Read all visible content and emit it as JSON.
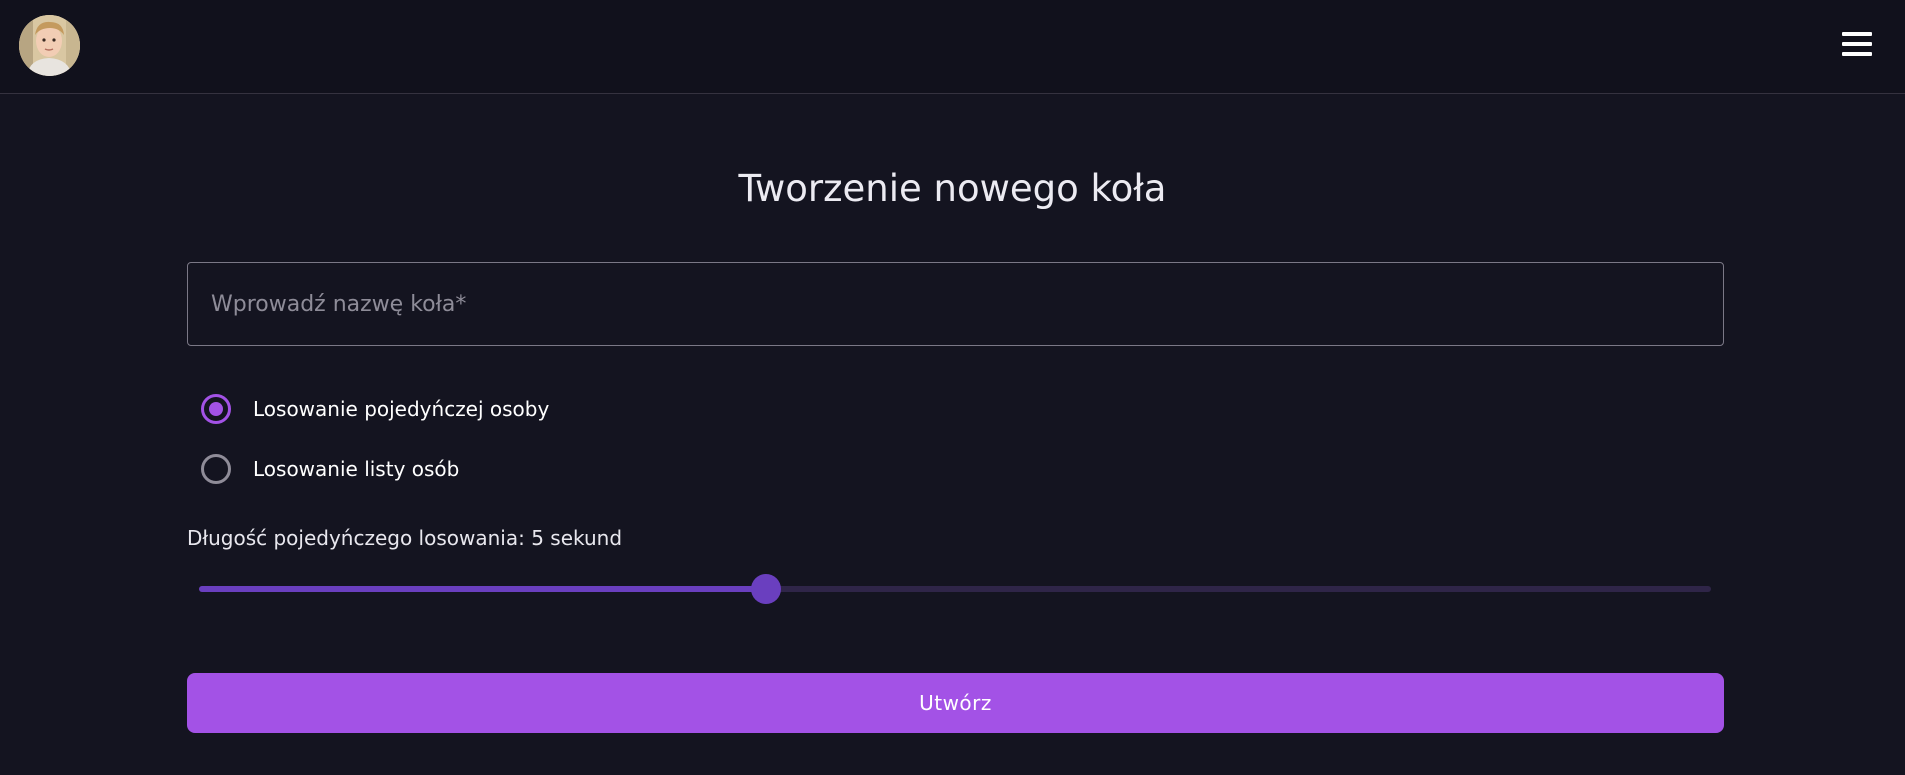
{
  "header": {
    "avatar_icon": "user-avatar-photo",
    "menu_icon": "hamburger-menu-icon"
  },
  "page": {
    "title": "Tworzenie nowego koła"
  },
  "form": {
    "name_input": {
      "placeholder": "Wprowadź nazwę koła*",
      "value": ""
    },
    "mode_options": [
      {
        "label": "Losowanie pojedyńczej osoby",
        "checked": true
      },
      {
        "label": "Losowanie listy osób",
        "checked": false
      }
    ],
    "duration": {
      "label": "Długość pojedyńczego losowania: 5 sekund",
      "fraction": 0.375
    },
    "submit_label": "Utwórz"
  },
  "colors": {
    "background": "#141420",
    "accent": "#a352e6",
    "slider": "#6a3fbf"
  }
}
